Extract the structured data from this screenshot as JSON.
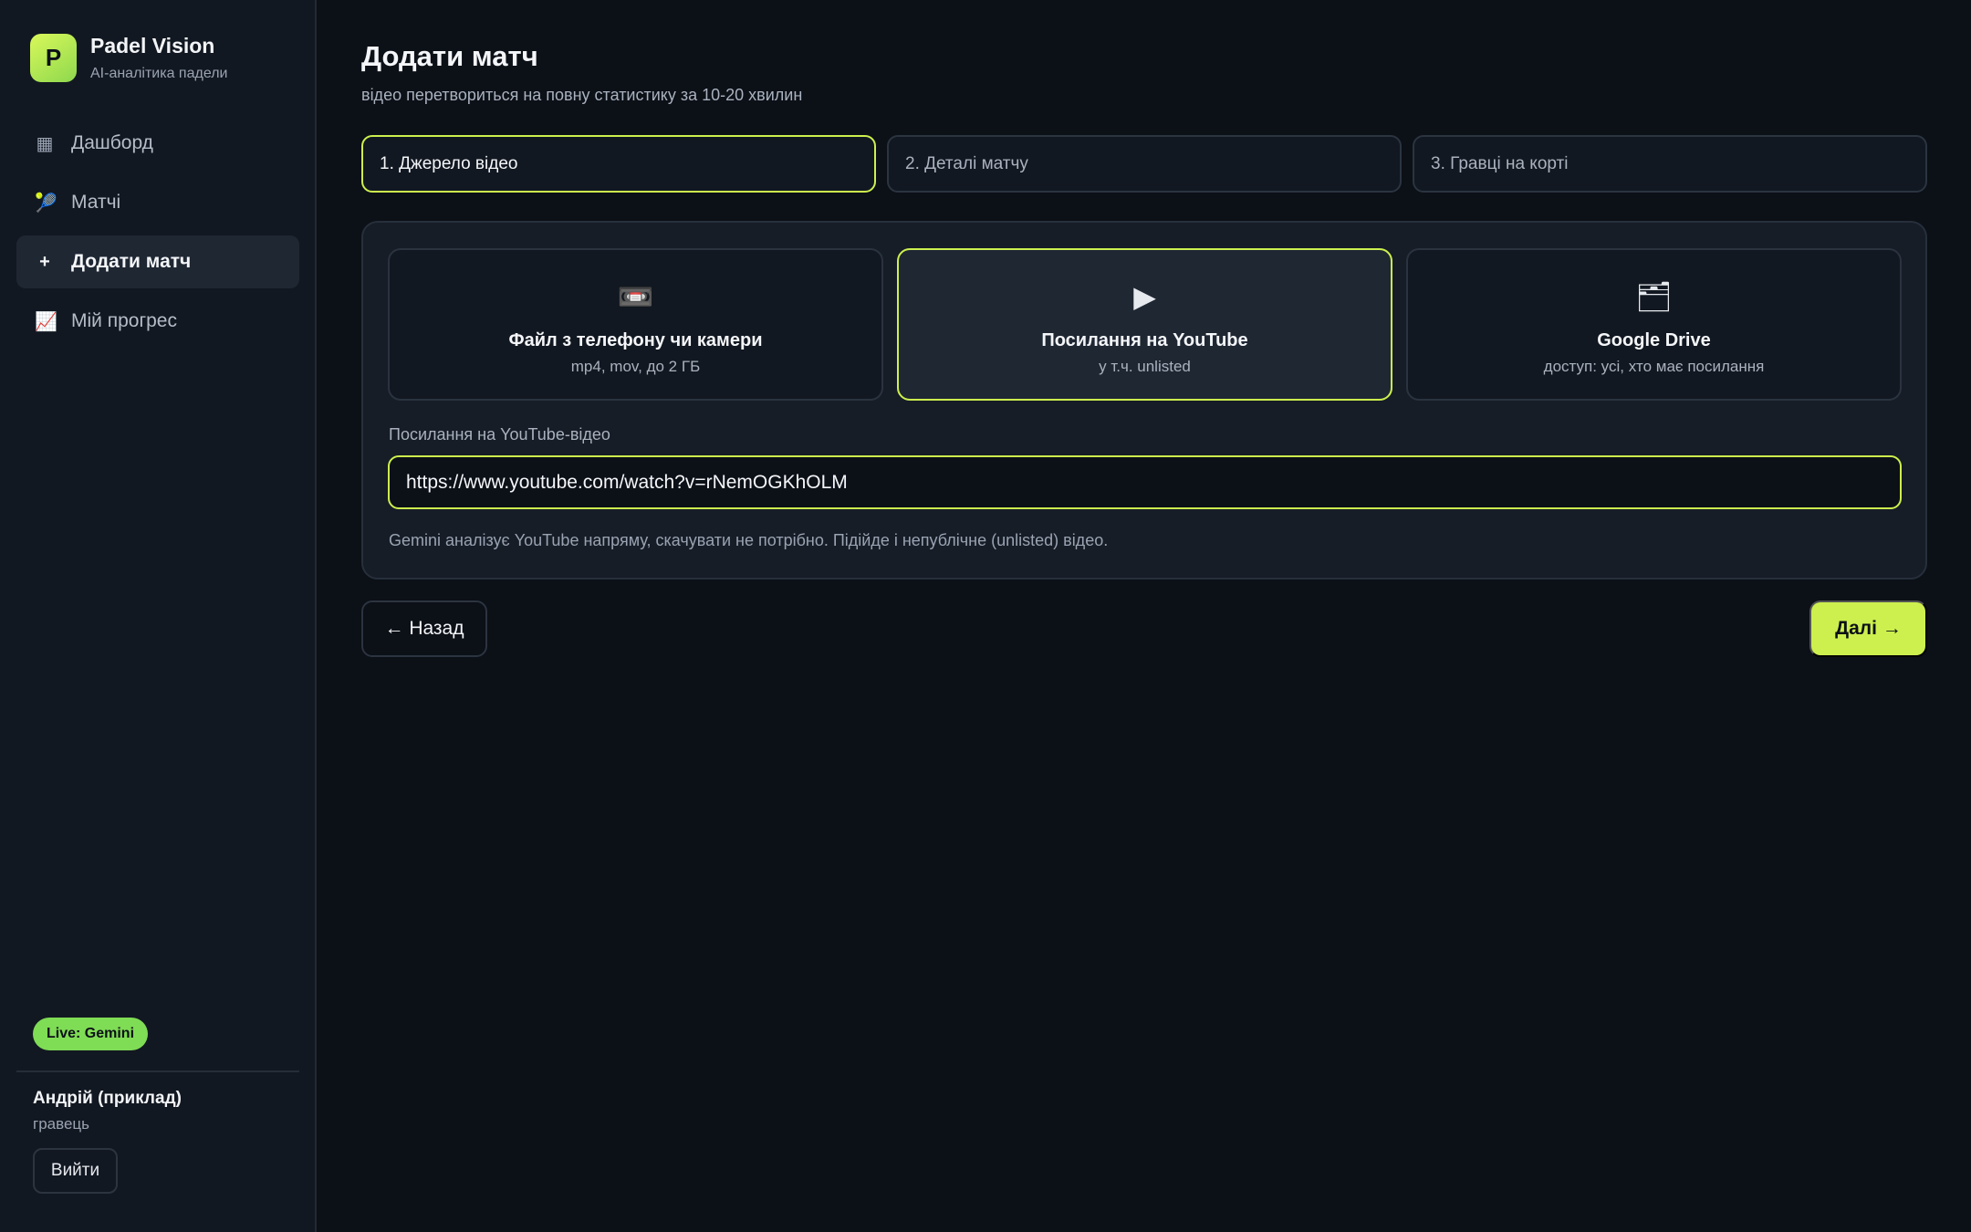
{
  "app": {
    "logo_letter": "P",
    "name": "Padel Vision",
    "tagline": "AI-аналітика падели"
  },
  "sidebar": {
    "items": [
      {
        "label": "Дашборд",
        "icon": "dashboard-icon",
        "glyph": "▦",
        "active": false
      },
      {
        "label": "Матчі",
        "icon": "tennis-racket-icon",
        "glyph": "🎾",
        "active": false
      },
      {
        "label": "Додати матч",
        "icon": "plus-icon",
        "glyph": "+",
        "active": true
      },
      {
        "label": "Мій прогрес",
        "icon": "chart-up-icon",
        "glyph": "📈",
        "active": false
      }
    ],
    "live_badge": "Live: Gemini",
    "user": {
      "name": "Андрій (приклад)",
      "role": "гравець",
      "logout_label": "Вийти"
    }
  },
  "page": {
    "title": "Додати матч",
    "subtitle": "відео перетвориться на повну статистику за 10-20 хвилин"
  },
  "steps": [
    {
      "label": "1. Джерело відео",
      "active": true
    },
    {
      "label": "2. Деталі матчу",
      "active": false
    },
    {
      "label": "3. Гравці на корті",
      "active": false
    }
  ],
  "sources": [
    {
      "icon": "videocassette-icon",
      "glyph": "📼",
      "title": "Файл з телефону чи камери",
      "desc": "mp4, mov, до 2 ГБ",
      "selected": false
    },
    {
      "icon": "play-icon",
      "glyph": "▶",
      "title": "Посилання на YouTube",
      "desc": "у т.ч. unlisted",
      "selected": true
    },
    {
      "icon": "folder-icon",
      "glyph": "🗂",
      "title": "Google Drive",
      "desc": "доступ: усі, хто має посилання",
      "selected": false
    }
  ],
  "youtube": {
    "label": "Посилання на YouTube-відео",
    "value": "https://www.youtube.com/watch?v=rNemOGKhOLM",
    "hint": "Gemini аналізує YouTube напряму, скачувати не потрібно. Підійде і непублічне (unlisted) відео."
  },
  "actions": {
    "back_label": "← Назад",
    "next_label": "Далі →"
  },
  "colors": {
    "accent": "#cdf04e",
    "live": "#7fdc55",
    "background": "#0c1017",
    "sidebar": "#121821"
  }
}
